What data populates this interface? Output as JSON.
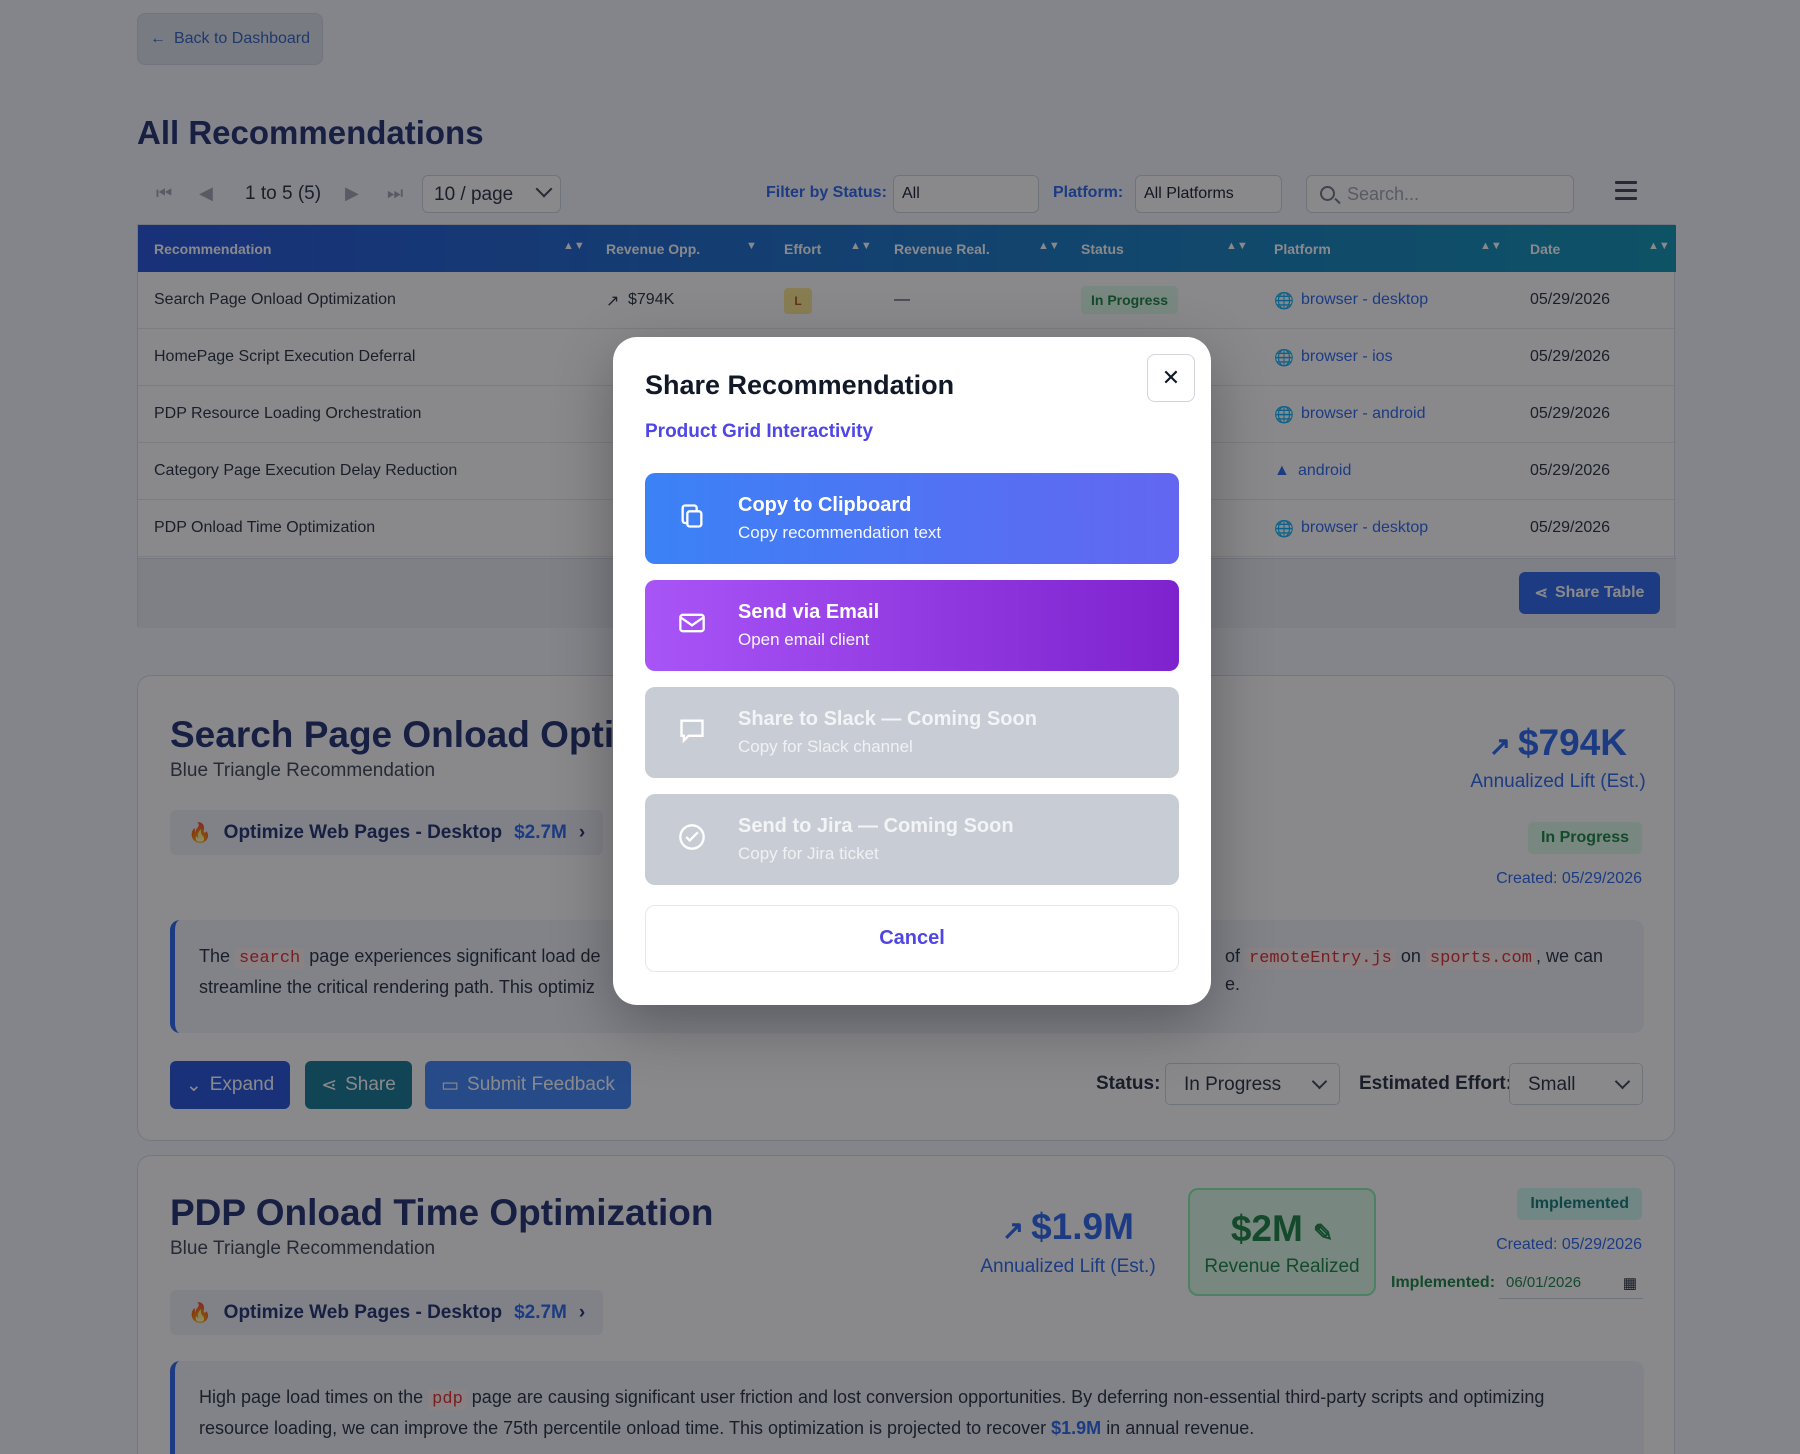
{
  "nav": {
    "back_label": "Back to Dashboard"
  },
  "page_title": "All Recommendations",
  "toolbar": {
    "page_range": "1 to 5 (5)",
    "per_page": "10 / page",
    "filter_status_label": "Filter by Status:",
    "filter_status_value": "All",
    "platform_label": "Platform:",
    "platform_value": "All Platforms",
    "search_placeholder": "Search..."
  },
  "table": {
    "columns": [
      "Recommendation",
      "Revenue Opp.",
      "Effort",
      "Revenue Real.",
      "Status",
      "Platform",
      "Date"
    ],
    "rows": [
      {
        "name": "Search Page Onload Optimization",
        "revenue": "$794K",
        "effort": "L",
        "realized": "—",
        "status": "In Progress",
        "platform": "browser - desktop",
        "date": "05/29/2026"
      },
      {
        "name": "HomePage Script Execution Deferral",
        "platform": "browser - ios",
        "date": "05/29/2026"
      },
      {
        "name": "PDP Resource Loading Orchestration",
        "platform": "browser - android",
        "date": "05/29/2026"
      },
      {
        "name": "Category Page Execution Delay Reduction",
        "platform": "android",
        "date": "05/29/2026"
      },
      {
        "name": "PDP Onload Time Optimization",
        "platform": "browser - desktop",
        "date": "05/29/2026"
      }
    ],
    "share_label": "Share Table"
  },
  "card1": {
    "title": "Search Page Onload Optimiz",
    "subtitle": "Blue Triangle Recommendation",
    "chip_label": "Optimize Web Pages - Desktop",
    "chip_amount": "$2.7M",
    "lift_amount": "$794K",
    "lift_label": "Annualized Lift (Est.)",
    "status_pill": "In Progress",
    "created": "Created: 05/29/2026",
    "desc_1": "The",
    "desc_code1": "search",
    "desc_2": "page experiences significant load de",
    "desc_3": "of",
    "desc_code2": "remoteEntry.js",
    "desc_4": "on",
    "desc_code3": "sports.com",
    "desc_5": ", we can",
    "desc_line2a": "streamline the critical rendering path. This optimiz",
    "desc_line2b": "e.",
    "expand_label": "Expand",
    "share_label": "Share",
    "feedback_label": "Submit Feedback",
    "status_label": "Status:",
    "status_value": "In Progress",
    "effort_label": "Estimated Effort:",
    "effort_value": "Small"
  },
  "card2": {
    "title": "PDP Onload Time Optimization",
    "subtitle": "Blue Triangle Recommendation",
    "chip_label": "Optimize Web Pages - Desktop",
    "chip_amount": "$2.7M",
    "lift_amount": "$1.9M",
    "lift_label": "Annualized Lift (Est.)",
    "realized_amount": "$2M",
    "realized_label": "Revenue Realized",
    "status_pill": "Implemented",
    "created": "Created: 05/29/2026",
    "implemented_label": "Implemented:",
    "implemented_date": "06/01/2026",
    "desc_1": "High page load times on the",
    "desc_code": "pdp",
    "desc_2": "page are causing significant user friction and lost conversion opportunities. By deferring non-essential third-party scripts and optimizing",
    "desc_3": "resource loading, we can improve the 75th percentile onload time. This optimization is projected to recover",
    "desc_amount": "$1.9M",
    "desc_4": "in annual revenue."
  },
  "modal": {
    "title": "Share Recommendation",
    "subtitle": "Product Grid Interactivity",
    "options": [
      {
        "title": "Copy to Clipboard",
        "sub": "Copy recommendation text"
      },
      {
        "title": "Send via Email",
        "sub": "Open email client"
      },
      {
        "title": "Share to Slack — Coming Soon",
        "sub": "Copy for Slack channel"
      },
      {
        "title": "Send to Jira — Coming Soon",
        "sub": "Copy for Jira ticket"
      }
    ],
    "cancel_label": "Cancel"
  },
  "colors": {
    "primary": "#2563eb",
    "modal_accent": "#4f46e5",
    "success": "#15803d"
  }
}
